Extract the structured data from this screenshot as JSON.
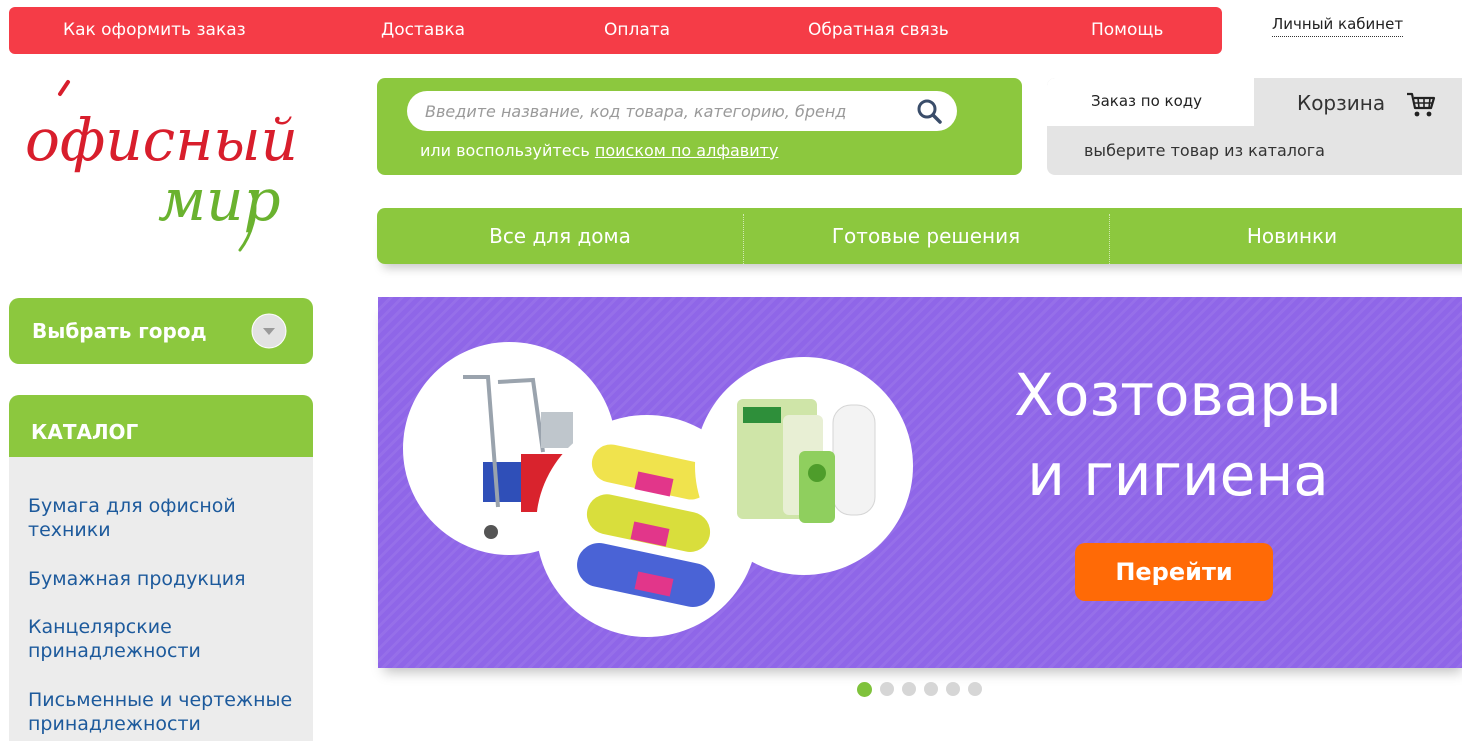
{
  "top_nav": {
    "items": [
      "Как оформить заказ",
      "Доставка",
      "Оплата",
      "Обратная связь",
      "Помощь"
    ],
    "cabinet": "Личный кабинет"
  },
  "logo": {
    "line1": "офисный",
    "line2": "мир"
  },
  "search": {
    "placeholder": "Введите название, код товара, категорию, бренд",
    "hint_prefix": "или воспользуйтесь",
    "hint_link": "поиском по алфавиту",
    "icon": "search-icon"
  },
  "cart": {
    "order_by_code": "Заказ по коду",
    "title": "Корзина",
    "icon": "cart-icon",
    "note": "выберите товар из каталога"
  },
  "main_menu": {
    "items": [
      "Все для дома",
      "Готовые решения",
      "Новинки"
    ]
  },
  "city": {
    "label": "Выбрать город",
    "icon": "chevron-down-icon"
  },
  "catalog": {
    "title": "КАТАЛОГ",
    "items": [
      "Бумага для офисной техники",
      "Бумажная продукция",
      "Канцелярские принадлежности",
      "Письменные и чертежные принадлежности"
    ]
  },
  "banner": {
    "title_line1": "Хозтовары",
    "title_line2": "и гигиена",
    "button": "Перейти",
    "slides_total": 6,
    "active_slide": 1
  },
  "colors": {
    "top_nav": "#f53c47",
    "green": "#8cc83e",
    "banner": "#8f66e8",
    "cta": "#ff6a06",
    "link": "#1d5a9c"
  }
}
